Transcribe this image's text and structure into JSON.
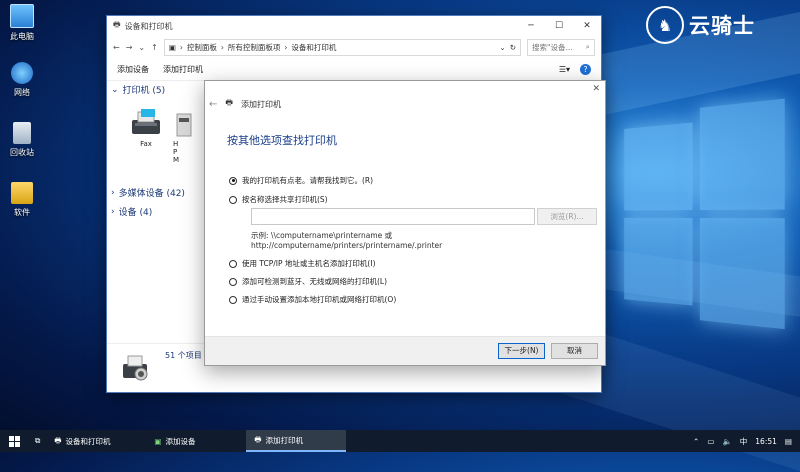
{
  "desktop": {
    "icons": [
      {
        "label": "此电脑",
        "icon": "computer-icon"
      },
      {
        "label": "网络",
        "icon": "network-icon"
      },
      {
        "label": "回收站",
        "icon": "recycle-bin-icon"
      },
      {
        "label": "软件",
        "icon": "folder-icon"
      }
    ],
    "watermark": "云骑士"
  },
  "explorer": {
    "title": "设备和打印机",
    "breadcrumb": [
      "控制面板",
      "所有控制面板项",
      "设备和打印机"
    ],
    "search_placeholder": "搜索\"设备...",
    "commands": [
      "添加设备",
      "添加打印机"
    ],
    "sections": [
      {
        "label": "打印机 (5)"
      },
      {
        "label": "多媒体设备 (42)"
      },
      {
        "label": "设备 (4)"
      }
    ],
    "devices": [
      {
        "label": "Fax"
      },
      {
        "label": "H\nP\nM"
      }
    ],
    "status_count": "51 个项目"
  },
  "dialog": {
    "title": "添加打印机",
    "heading": "按其他选项查找打印机",
    "options": [
      {
        "label": "我的打印机有点老。请帮我找到它。(R)",
        "selected": true
      },
      {
        "label": "按名称选择共享打印机(S)",
        "selected": false
      },
      {
        "label": "使用 TCP/IP 地址或主机名添加打印机(I)",
        "selected": false
      },
      {
        "label": "添加可检测到蓝牙、无线或网络的打印机(L)",
        "selected": false
      },
      {
        "label": "通过手动设置添加本地打印机或网络打印机(O)",
        "selected": false
      }
    ],
    "printer_name_value": "",
    "browse_label": "浏览(R)...",
    "example_line1": "示例: \\\\computername\\printername 或",
    "example_line2": "http://computername/printers/printername/.printer",
    "next_label": "下一步(N)",
    "cancel_label": "取消"
  },
  "taskbar": {
    "items": [
      {
        "label": "设备和打印机",
        "active": false
      },
      {
        "label": "添加设备",
        "active": false
      },
      {
        "label": "添加打印机",
        "active": true
      }
    ],
    "ime": "中",
    "clock": "16:51"
  },
  "colors": {
    "accent": "#1e6fd6",
    "heading": "#1a3f8b",
    "taskbar": "#101c2d"
  }
}
